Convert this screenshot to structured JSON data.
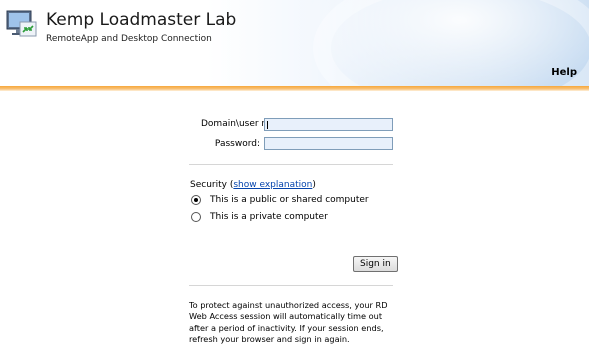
{
  "header": {
    "title": "Kemp Loadmaster Lab",
    "subtitle": "RemoteApp and Desktop Connection",
    "help_label": "Help",
    "logo_icon": "remote-desktop-icon",
    "accent_color": "#f7a83a"
  },
  "login": {
    "username_label": "Domain\\user name:",
    "username_value": "",
    "password_label": "Password:",
    "password_value": ""
  },
  "security": {
    "label": "Security",
    "open_paren": "(",
    "explanation_link": "show explanation",
    "close_paren": ")",
    "options": [
      {
        "label": "This is a public or shared computer",
        "selected": true
      },
      {
        "label": "This is a private computer",
        "selected": false
      }
    ]
  },
  "actions": {
    "sign_in_label": "Sign in"
  },
  "notice": {
    "text": "To protect against unauthorized access, your RD Web Access session will automatically time out after a period of inactivity. If your session ends, refresh your browser and sign in again."
  }
}
